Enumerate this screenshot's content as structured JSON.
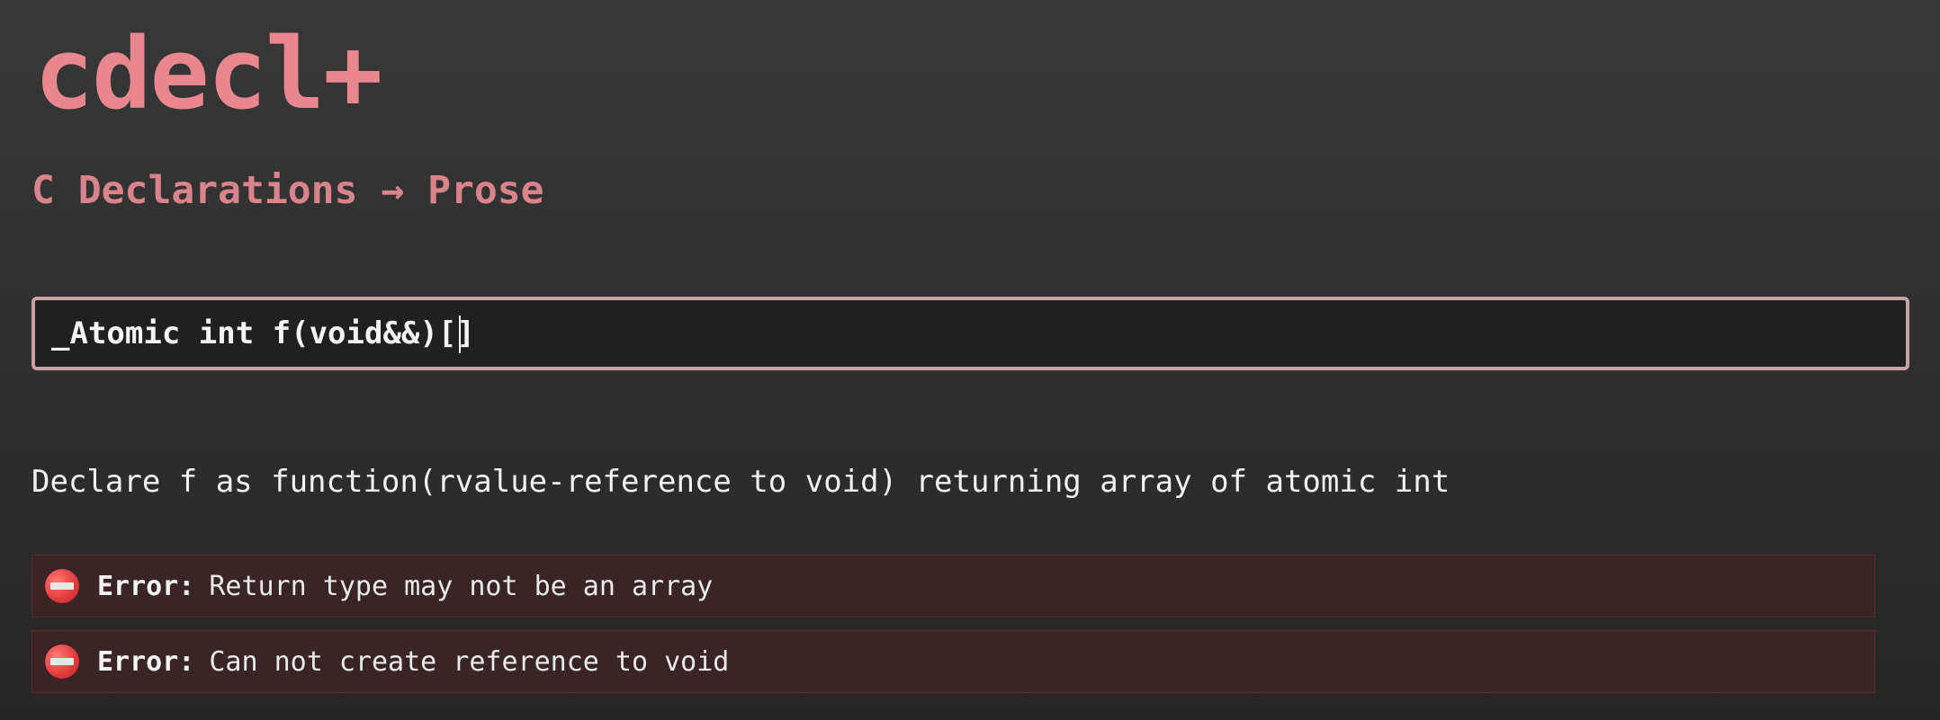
{
  "app": {
    "title": "cdecl+",
    "subtitle": "C Declarations → Prose"
  },
  "declaration_input": {
    "value": "_Atomic int f(void&&)[]"
  },
  "output": {
    "prose": "Declare f as function(rvalue-reference to void) returning array of atomic int"
  },
  "errors": [
    {
      "label": "Error:",
      "message": "Return type may not be an array",
      "icon": "error-stop-icon"
    },
    {
      "label": "Error:",
      "message": "Can not create reference to void",
      "icon": "error-stop-icon"
    }
  ],
  "colors": {
    "accent": "#e8888e",
    "input_border": "#c7a2a6",
    "error_background": "#3a2425",
    "error_icon": "#e23a3a"
  }
}
